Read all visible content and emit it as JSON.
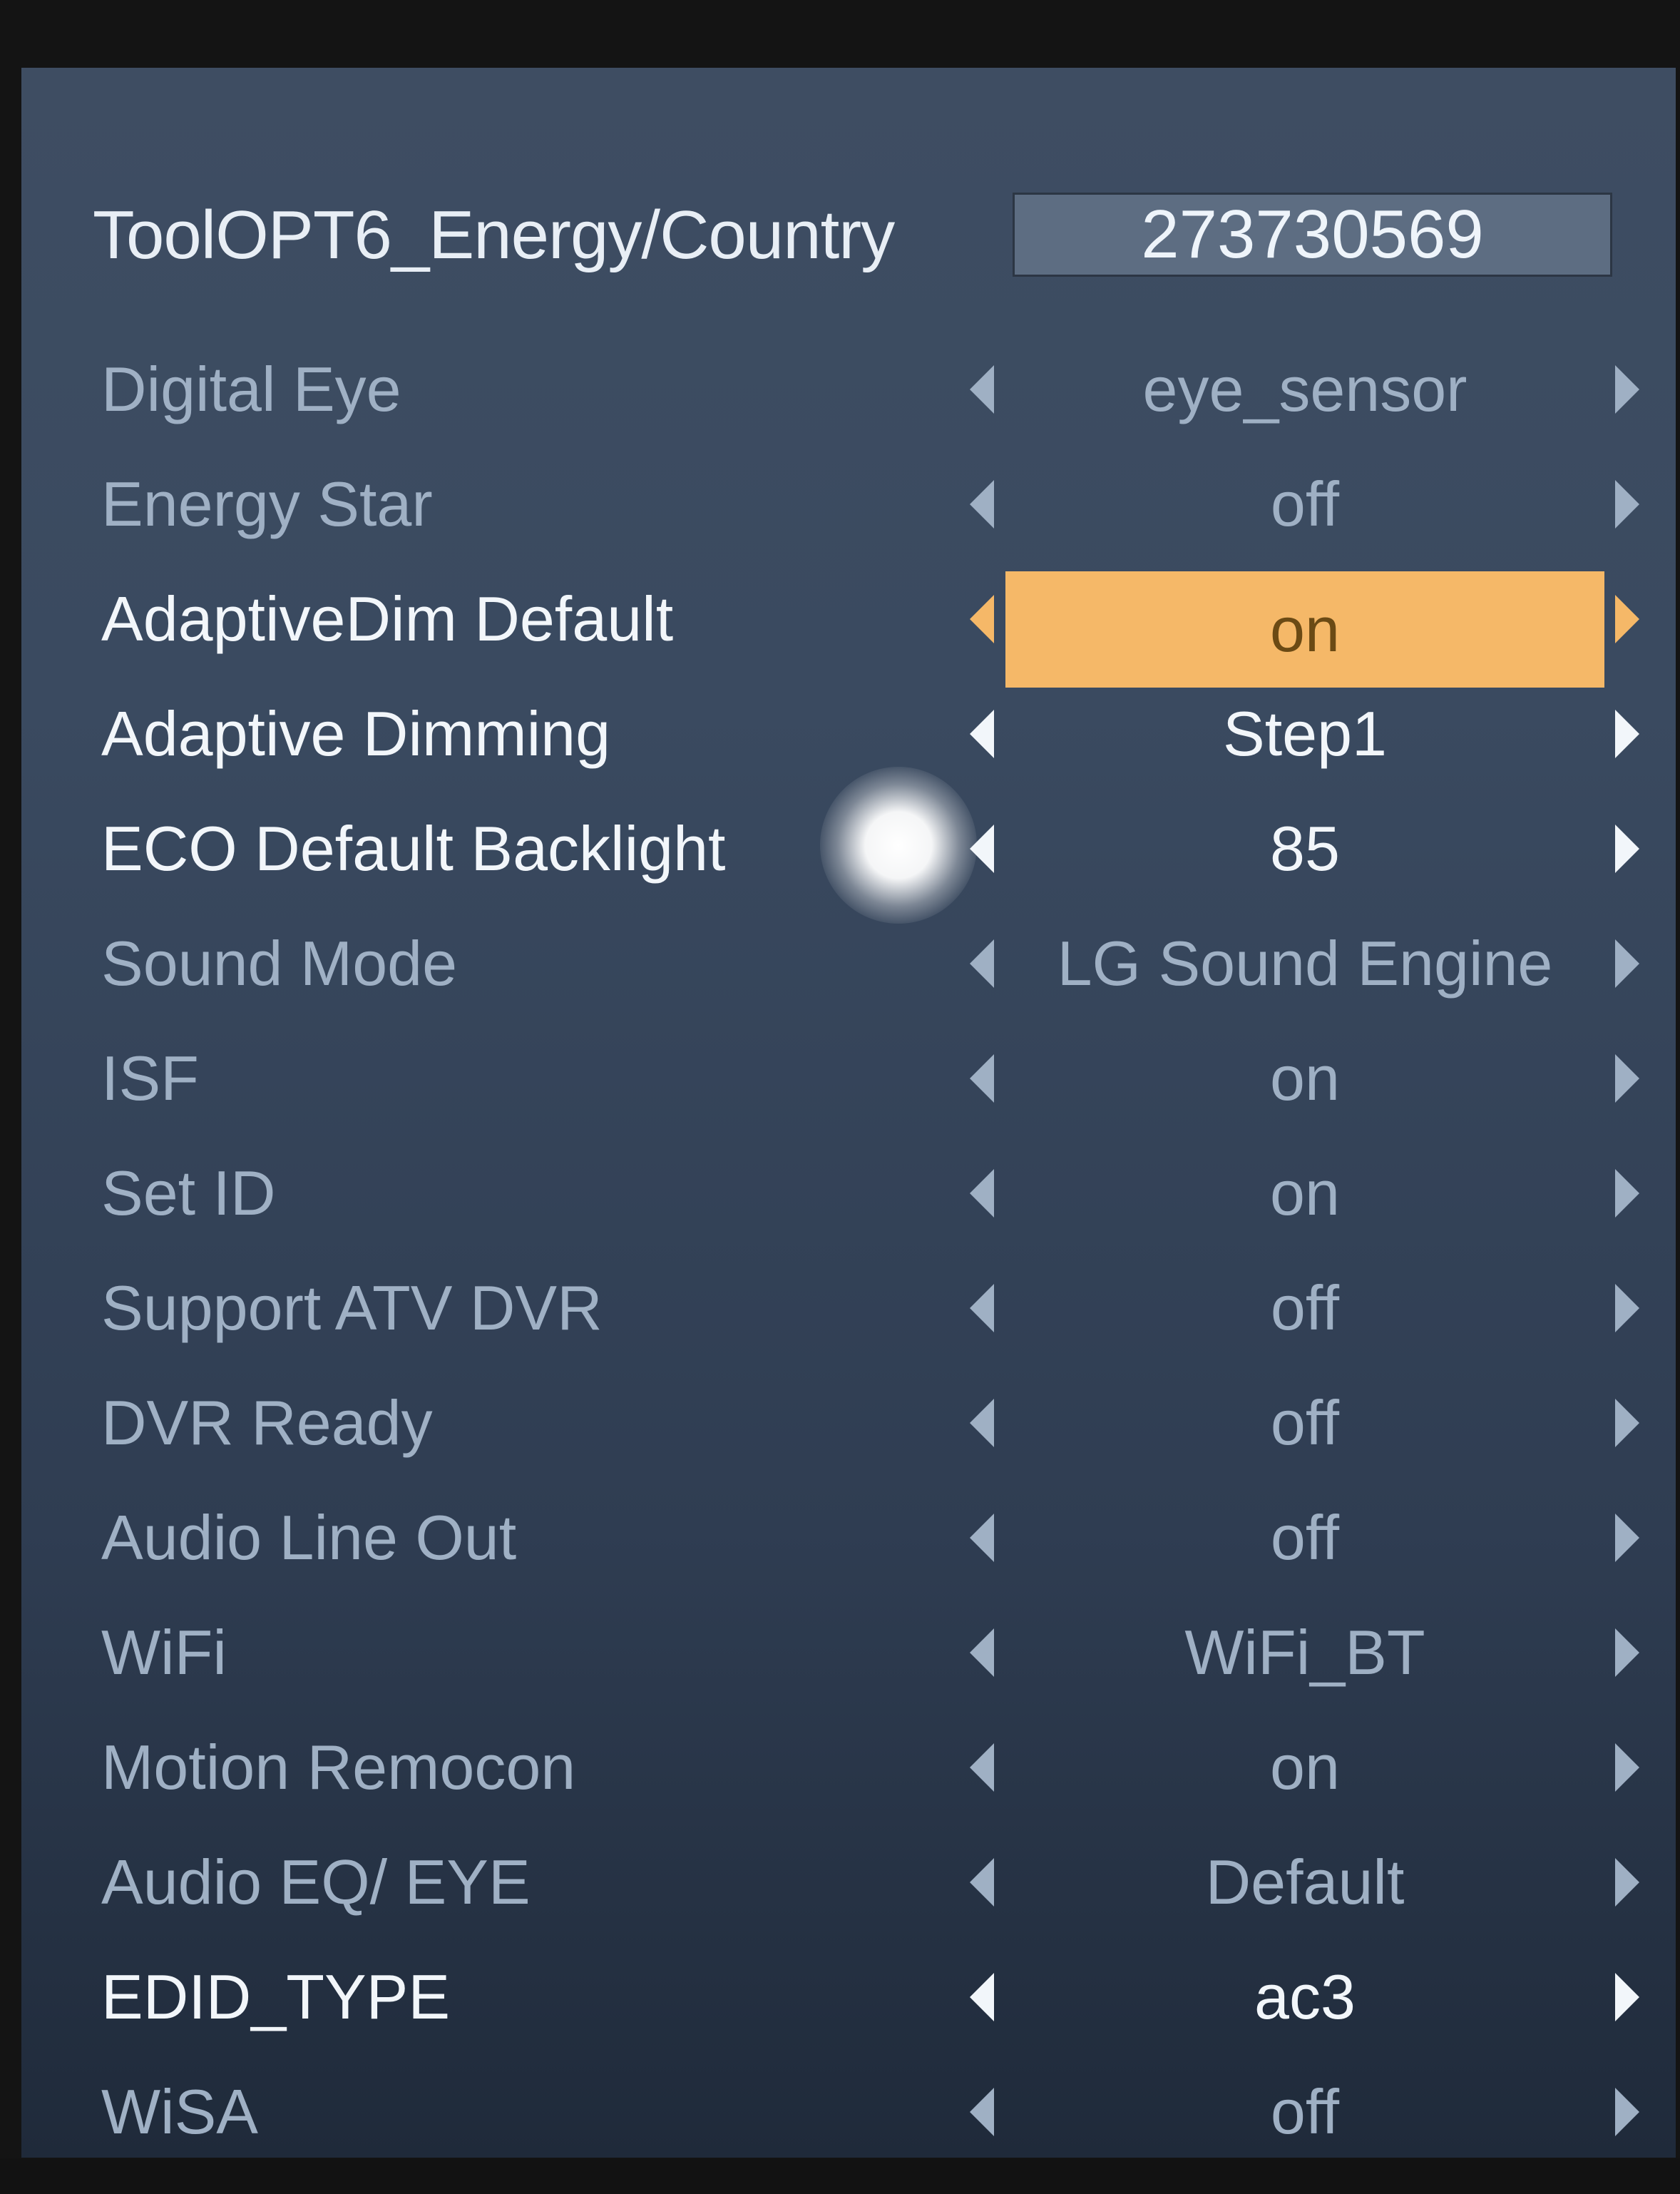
{
  "header": {
    "title": "ToolOPT6_Energy/Country",
    "value": "273730569"
  },
  "colors": {
    "highlight": "#f5b868",
    "highlight_text": "#6b4a14",
    "text_active": "#f2f6fa",
    "text_dim": "#9fb0c4",
    "background": "#3a4a60"
  },
  "options": [
    {
      "label": "Digital Eye",
      "value": "eye_sensor",
      "state": "dim"
    },
    {
      "label": "Energy Star",
      "value": "off",
      "state": "dim"
    },
    {
      "label": "AdaptiveDim Default",
      "value": "on",
      "state": "selected"
    },
    {
      "label": "Adaptive Dimming",
      "value": "Step1",
      "state": "bright"
    },
    {
      "label": "ECO Default Backlight",
      "value": "85",
      "state": "bright"
    },
    {
      "label": "Sound Mode",
      "value": "LG Sound Engine",
      "state": "dim"
    },
    {
      "label": "ISF",
      "value": "on",
      "state": "dim"
    },
    {
      "label": "Set ID",
      "value": "on",
      "state": "dim"
    },
    {
      "label": "Support ATV DVR",
      "value": "off",
      "state": "dim"
    },
    {
      "label": "DVR Ready",
      "value": "off",
      "state": "dim"
    },
    {
      "label": "Audio Line Out",
      "value": "off",
      "state": "dim"
    },
    {
      "label": "WiFi",
      "value": "WiFi_BT",
      "state": "dim"
    },
    {
      "label": "Motion Remocon",
      "value": "on",
      "state": "dim"
    },
    {
      "label": "Audio EQ/ EYE",
      "value": "Default",
      "state": "dim"
    },
    {
      "label": "EDID_TYPE",
      "value": "ac3",
      "state": "bright"
    },
    {
      "label": "WiSA",
      "value": "off",
      "state": "dim"
    }
  ]
}
